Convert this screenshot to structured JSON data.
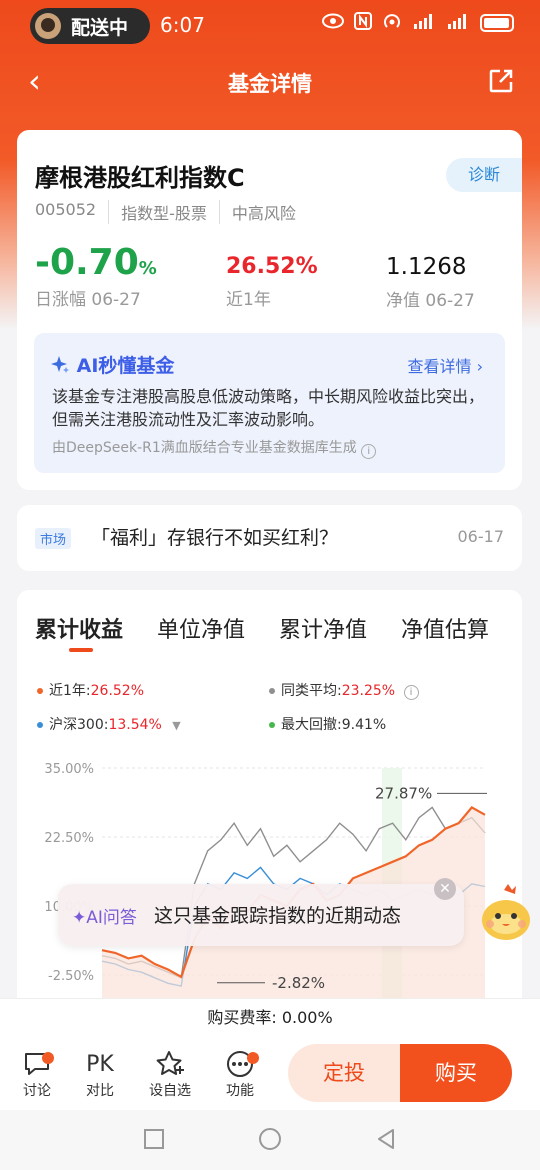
{
  "status": {
    "app_pill": "配送中",
    "time": "6:07"
  },
  "nav": {
    "title": "基金详情"
  },
  "fund": {
    "name": "摩根港股红利指数C",
    "diagnose_label": "诊断",
    "code": "005052",
    "type": "指数型-股票",
    "risk": "中高风险",
    "daily_change_value": "-0.70",
    "daily_change_unit": "%",
    "daily_change_label": "日涨幅 06-27",
    "year_return_value": "26.52%",
    "year_return_label": "近1年",
    "nav_value": "1.1268",
    "nav_label": "净值 06-27"
  },
  "ai_summary": {
    "title": "AI秒懂基金",
    "link": "查看详情",
    "body": "该基金专注港股高股息低波动策略，中长期风险收益比突出，但需关注港股流动性及汇率波动影响。",
    "source": "由DeepSeek-R1满血版结合专业基金数据库生成"
  },
  "news": {
    "tag": "市场",
    "title": "「福利」存银行不如买红利？",
    "date": "06-17"
  },
  "chart_tabs": [
    "累计收益",
    "单位净值",
    "累计净值",
    "净值估算"
  ],
  "legend": {
    "fund_label": "近1年:",
    "fund_value": "26.52%",
    "peer_label": "同类平均:",
    "peer_value": "23.25%",
    "index_label": "沪深300:",
    "index_value": "13.54%",
    "drawdown_label": "最大回撤:",
    "drawdown_value": "9.41%"
  },
  "colors": {
    "fund": "#f0662a",
    "peer": "#8f8f8f",
    "index": "#3a8fd6",
    "drawdown": "#46b84a",
    "brand": "#ee4a1c"
  },
  "chart_data": {
    "type": "line",
    "y_tick_labels": [
      "35.00%",
      "22.50%",
      "10.00%",
      "-2.50%"
    ],
    "annotations": {
      "high": "27.87%",
      "low": "-2.82%"
    },
    "series": [
      {
        "name": "近1年",
        "values": [
          2,
          1.5,
          0.5,
          1,
          -0.5,
          -1.5,
          -2.82,
          4,
          8,
          6,
          10,
          9,
          12,
          11,
          10,
          13,
          14,
          11,
          12,
          15,
          16,
          17,
          18,
          19,
          21,
          22,
          24,
          25,
          27.87,
          26.52
        ]
      },
      {
        "name": "同类平均",
        "values": [
          1,
          0.5,
          -0.5,
          0,
          -1,
          -2,
          -3,
          14,
          20,
          22,
          25,
          21,
          24,
          19,
          21,
          18,
          20,
          22,
          25,
          23,
          20,
          24,
          25,
          22,
          26,
          27.87,
          24,
          25,
          26,
          23.25
        ]
      },
      {
        "name": "沪深300",
        "values": [
          0,
          -0.5,
          -1.5,
          -2,
          -3,
          -4,
          -4.5,
          10,
          14,
          13,
          16,
          15,
          17,
          14,
          13,
          15,
          14,
          12,
          14,
          13,
          12,
          13,
          11,
          12,
          13,
          12,
          13,
          12,
          14,
          13.54
        ]
      }
    ],
    "max_drawdown": "9.41%"
  },
  "ai_float": {
    "label": "AI问答",
    "question": "这只基金跟踪指数的近期动态"
  },
  "fee": {
    "text": "购买费率: 0.00%"
  },
  "bottom": {
    "discuss": "讨论",
    "compare_icon": "PK",
    "compare": "对比",
    "watch": "设自选",
    "functions": "功能",
    "sip_button": "定投",
    "buy_button": "购买"
  }
}
